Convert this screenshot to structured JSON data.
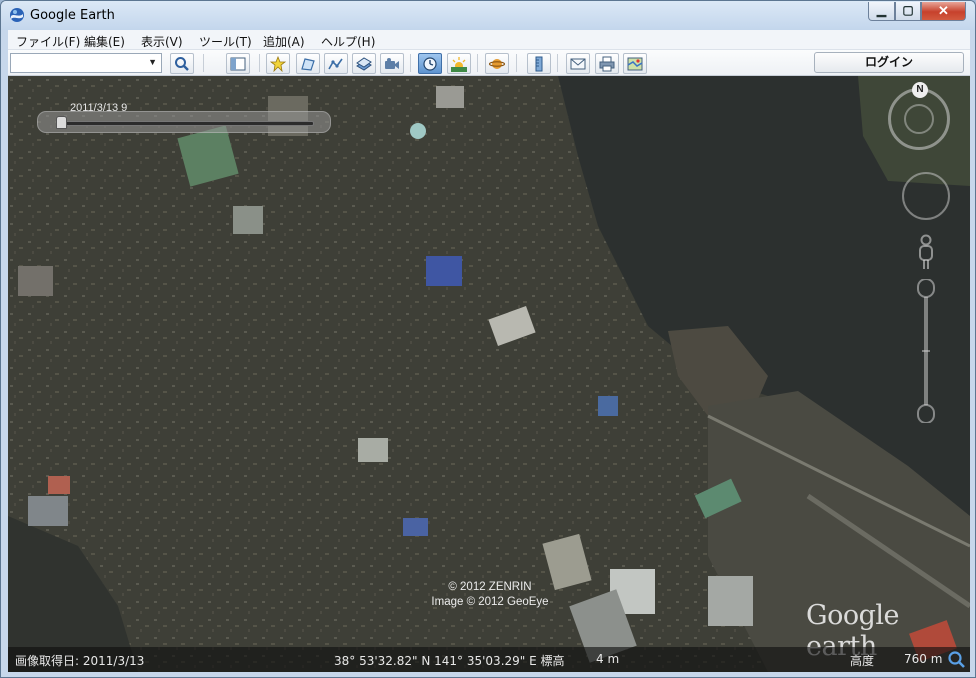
{
  "window": {
    "title": "Google Earth",
    "controls": {
      "minimize": "▁",
      "maximize": "▢",
      "close": "✕"
    }
  },
  "menu": {
    "items": [
      {
        "label": "ファイル(F)"
      },
      {
        "label": "編集(E)"
      },
      {
        "label": "表示(V)"
      },
      {
        "label": "ツール(T)"
      },
      {
        "label": "追加(A)"
      },
      {
        "label": "ヘルプ(H)"
      }
    ]
  },
  "toolbar": {
    "search_value": "",
    "login_label": "ログイン",
    "buttons": [
      "search-icon",
      "sidebar-toggle-icon",
      "add-placemark-icon",
      "add-polygon-icon",
      "add-path-icon",
      "add-image-overlay-icon",
      "record-tour-icon",
      "historical-imagery-icon",
      "sunlight-icon",
      "planets-icon",
      "ruler-icon",
      "email-icon",
      "print-icon",
      "view-in-maps-icon"
    ]
  },
  "map": {
    "time_slider": {
      "date_label": "2011/3/13  9"
    },
    "compass": {
      "north_label": "N"
    },
    "copyright": {
      "line1": "© 2012 ZENRIN",
      "line2": "Image © 2012 GeoEye"
    },
    "logo_text": "Google earth"
  },
  "status_bar": {
    "imagery_date": "画像取得日: 2011/3/13",
    "coordinates": "38° 53'32.82\" N 141° 35'03.29\" E 標高",
    "elevation": "4 m",
    "altitude_label": "高度",
    "altitude_value": "760 m"
  },
  "colors": {
    "title_bar": "#c9daee",
    "map_land": "#3a3c35",
    "map_water": "#2b302f",
    "active_button": "#6fa2d8",
    "close_button": "#c7412c"
  }
}
